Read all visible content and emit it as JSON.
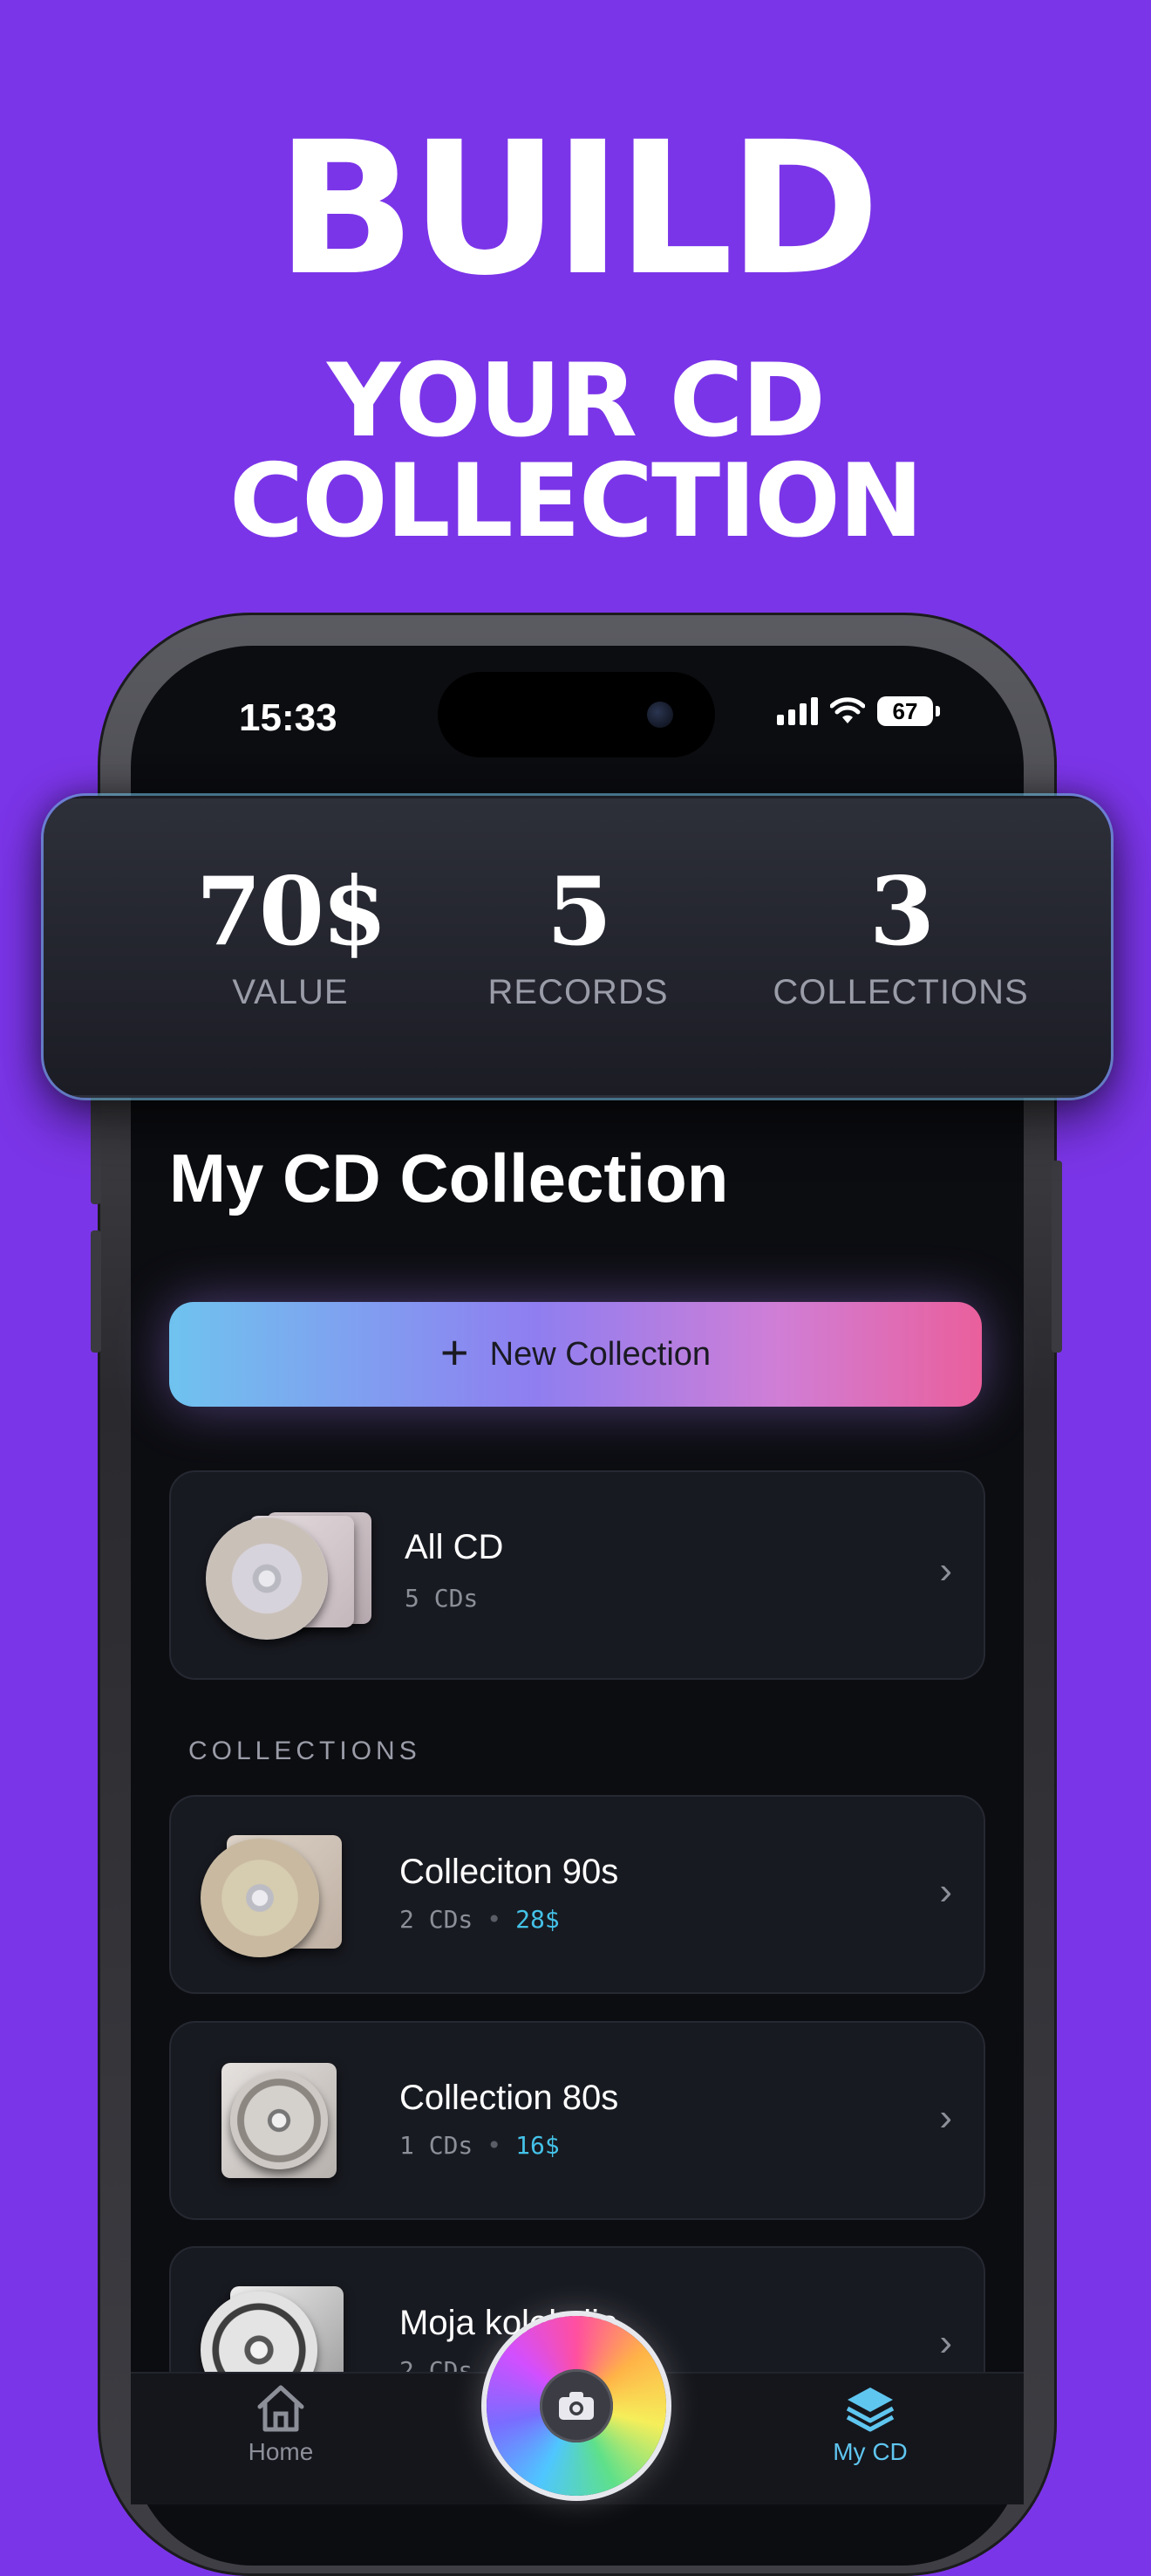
{
  "promo": {
    "line1": "BUILD",
    "line2": "YOUR CD",
    "line3": "COLLECTION",
    "background": "#7b35e8"
  },
  "status_bar": {
    "time": "15:33",
    "battery": "67"
  },
  "stats": {
    "value": {
      "number": "70$",
      "label": "VALUE"
    },
    "records": {
      "number": "5",
      "label": "RECORDS"
    },
    "collections": {
      "number": "3",
      "label": "COLLECTIONS"
    }
  },
  "page_title": "My CD Collection",
  "new_collection_button": {
    "icon": "plus-icon",
    "label": "New Collection"
  },
  "all_cd": {
    "title": "All CD",
    "count": "5 CDs"
  },
  "section_label": "COLLECTIONS",
  "collections": [
    {
      "title": "Colleciton 90s",
      "count": "2 CDs",
      "separator": "•",
      "price": "28$"
    },
    {
      "title": "Collection 80s",
      "count": "1 CDs",
      "separator": "•",
      "price": "16$"
    },
    {
      "title": "Moja kolekcija",
      "count": "2 CDs",
      "separator": "•",
      "price": ""
    }
  ],
  "tabbar": {
    "home": {
      "label": "Home",
      "icon": "home-icon"
    },
    "scan": {
      "icon": "camera-icon"
    },
    "my_cd": {
      "label": "My CD",
      "icon": "layers-icon"
    }
  },
  "colors": {
    "accent_price": "#44c2e8",
    "tab_active": "#5fc6f0",
    "tab_inactive": "#8c8e98"
  }
}
